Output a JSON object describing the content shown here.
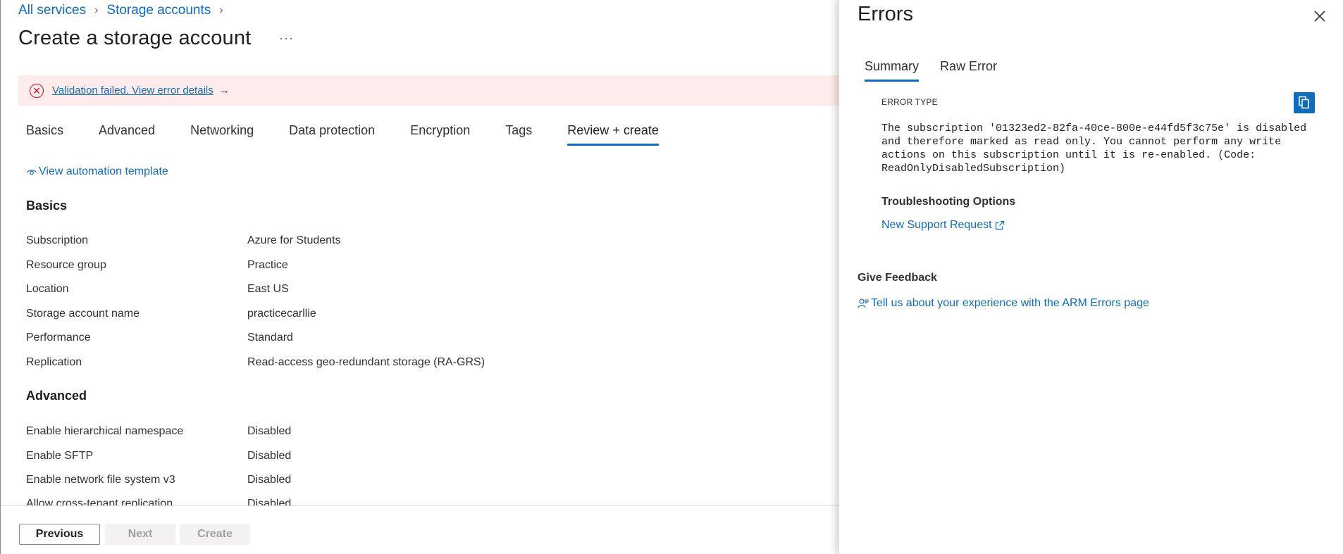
{
  "breadcrumb": [
    {
      "label": "All services"
    },
    {
      "label": "Storage accounts"
    }
  ],
  "page_title": "Create a storage account",
  "more_label": "···",
  "banner": {
    "text": "Validation failed. View error details",
    "arrow": "→"
  },
  "tabs": [
    {
      "label": "Basics",
      "active": false
    },
    {
      "label": "Advanced",
      "active": false
    },
    {
      "label": "Networking",
      "active": false
    },
    {
      "label": "Data protection",
      "active": false
    },
    {
      "label": "Encryption",
      "active": false
    },
    {
      "label": "Tags",
      "active": false
    },
    {
      "label": "Review + create",
      "active": true
    }
  ],
  "automation_link": "View automation template",
  "sections": {
    "basics": {
      "heading": "Basics",
      "rows": [
        {
          "label": "Subscription",
          "value": "Azure for Students"
        },
        {
          "label": "Resource group",
          "value": "Practice"
        },
        {
          "label": "Location",
          "value": "East US"
        },
        {
          "label": "Storage account name",
          "value": "practicecarllie"
        },
        {
          "label": "Performance",
          "value": "Standard"
        },
        {
          "label": "Replication",
          "value": "Read-access geo-redundant storage (RA-GRS)"
        }
      ]
    },
    "advanced": {
      "heading": "Advanced",
      "rows": [
        {
          "label": "Enable hierarchical namespace",
          "value": "Disabled"
        },
        {
          "label": "Enable SFTP",
          "value": "Disabled"
        },
        {
          "label": "Enable network file system v3",
          "value": "Disabled"
        },
        {
          "label": "Allow cross-tenant replication",
          "value": "Disabled"
        }
      ]
    }
  },
  "footer": {
    "previous": "Previous",
    "next": "Next",
    "create": "Create"
  },
  "errors_panel": {
    "title": "Errors",
    "tabs": [
      {
        "label": "Summary",
        "active": true
      },
      {
        "label": "Raw Error",
        "active": false
      }
    ],
    "error_type_label": "ERROR TYPE",
    "error_message": "The subscription '01323ed2-82fa-40ce-800e-e44fd5f3c75e' is disabled and therefore marked as read only. You cannot perform any write actions on this subscription until it is re-enabled. (Code: ReadOnlyDisabledSubscription)",
    "troubleshooting_heading": "Troubleshooting Options",
    "support_link": "New Support Request",
    "feedback_heading": "Give Feedback",
    "feedback_link": "Tell us about your experience with the ARM Errors page"
  },
  "colors": {
    "accent": "#0f6cbd",
    "error": "#c50f1f",
    "banner_bg": "#fdeceb"
  }
}
